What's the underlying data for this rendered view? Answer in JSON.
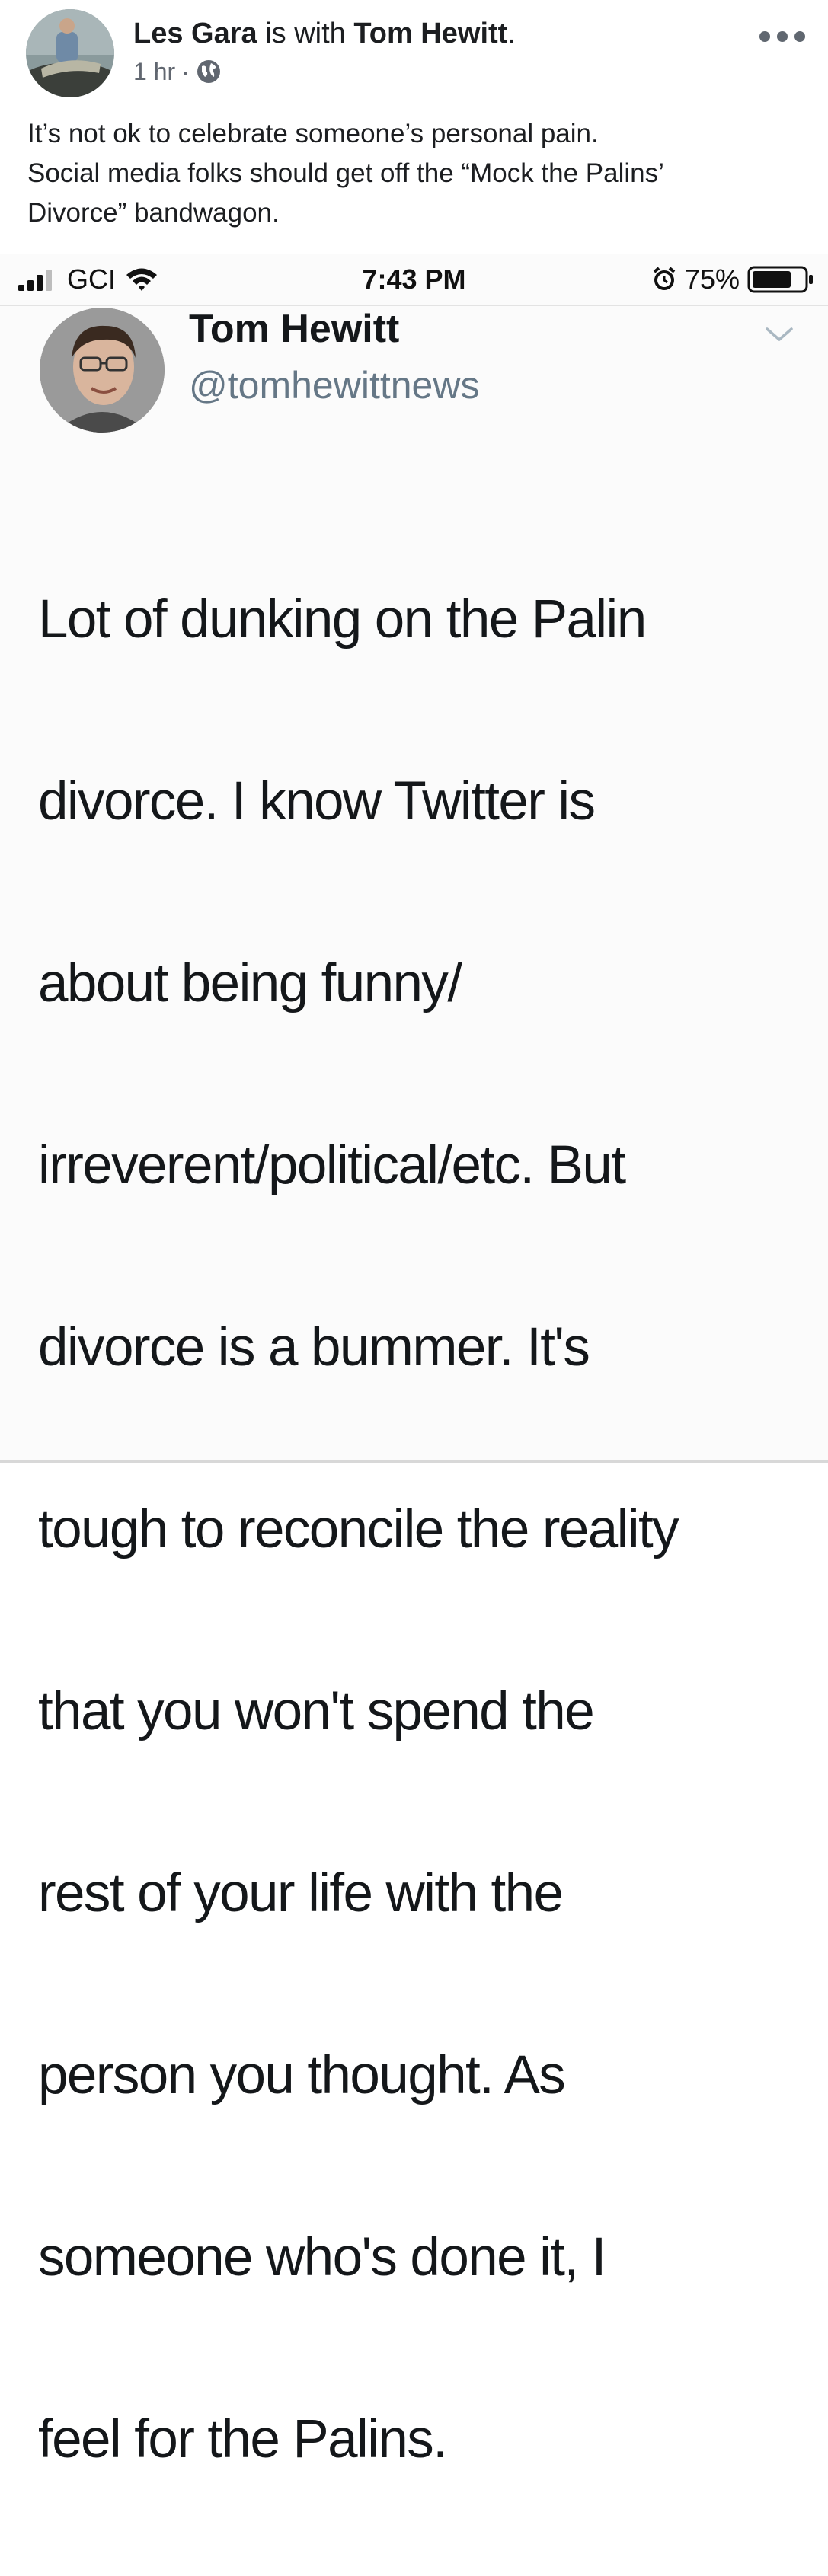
{
  "post": {
    "author": "Les Gara",
    "with_text": "is with",
    "tagged": "Tom Hewitt",
    "period": ".",
    "time": "1 hr",
    "separator": "·",
    "audience_icon": "globe-icon",
    "more_icon": "more-options-icon",
    "text_line_1": "It’s not ok to celebrate someone’s personal pain.",
    "text_line_2": "Social media folks should get off the “Mock the Palins’",
    "text_line_3": "Divorce” bandwagon."
  },
  "embedded_screenshot": {
    "status_bar": {
      "carrier": "GCI",
      "time": "7:43 PM",
      "battery": "75%",
      "battery_level": 0.75,
      "icons": [
        "signal-icon",
        "wifi-icon",
        "alarm-icon",
        "battery-icon"
      ]
    },
    "tweet": {
      "name": "Tom Hewitt",
      "handle": "@tomhewittnews",
      "chevron_icon": "chevron-down-icon",
      "lines": [
        "Lot of dunking on the Palin",
        "divorce. I know Twitter is",
        "about being funny/",
        "irreverent/political/etc. But",
        "divorce is a bummer. It's",
        "tough to reconcile the reality",
        "that you won't spend the",
        "rest of your life with the",
        "person you thought. As",
        "someone who's done it, I",
        "feel for the Palins."
      ]
    }
  },
  "colors": {
    "text_primary": "#1c1e21",
    "text_secondary": "#616770",
    "tweet_handle": "#657786"
  }
}
